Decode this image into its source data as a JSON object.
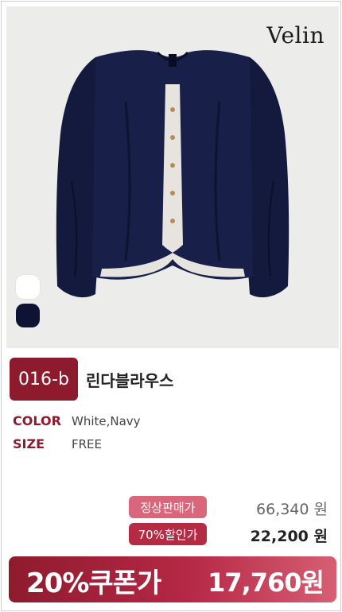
{
  "brand": {
    "logo_text": "Velin"
  },
  "product": {
    "code": "016-b",
    "name": "린다블라우스",
    "color_label": "COLOR",
    "color_value": "White,Navy",
    "size_label": "SIZE",
    "size_value": "FREE",
    "swatches": [
      {
        "name": "white",
        "hex": "#ffffff"
      },
      {
        "name": "navy",
        "hex": "#0f1333"
      }
    ]
  },
  "pricing": {
    "regular_label": "정상판매가",
    "regular_price": "66,340 원",
    "discount_label": "70%할인가",
    "discount_price": "22,200 원",
    "coupon_label": "20%쿠폰가",
    "coupon_price": "17,760원"
  },
  "colors": {
    "accent": "#8e1b2d",
    "pill_light": "#d9667a",
    "pill_dark": "#b52b44"
  }
}
